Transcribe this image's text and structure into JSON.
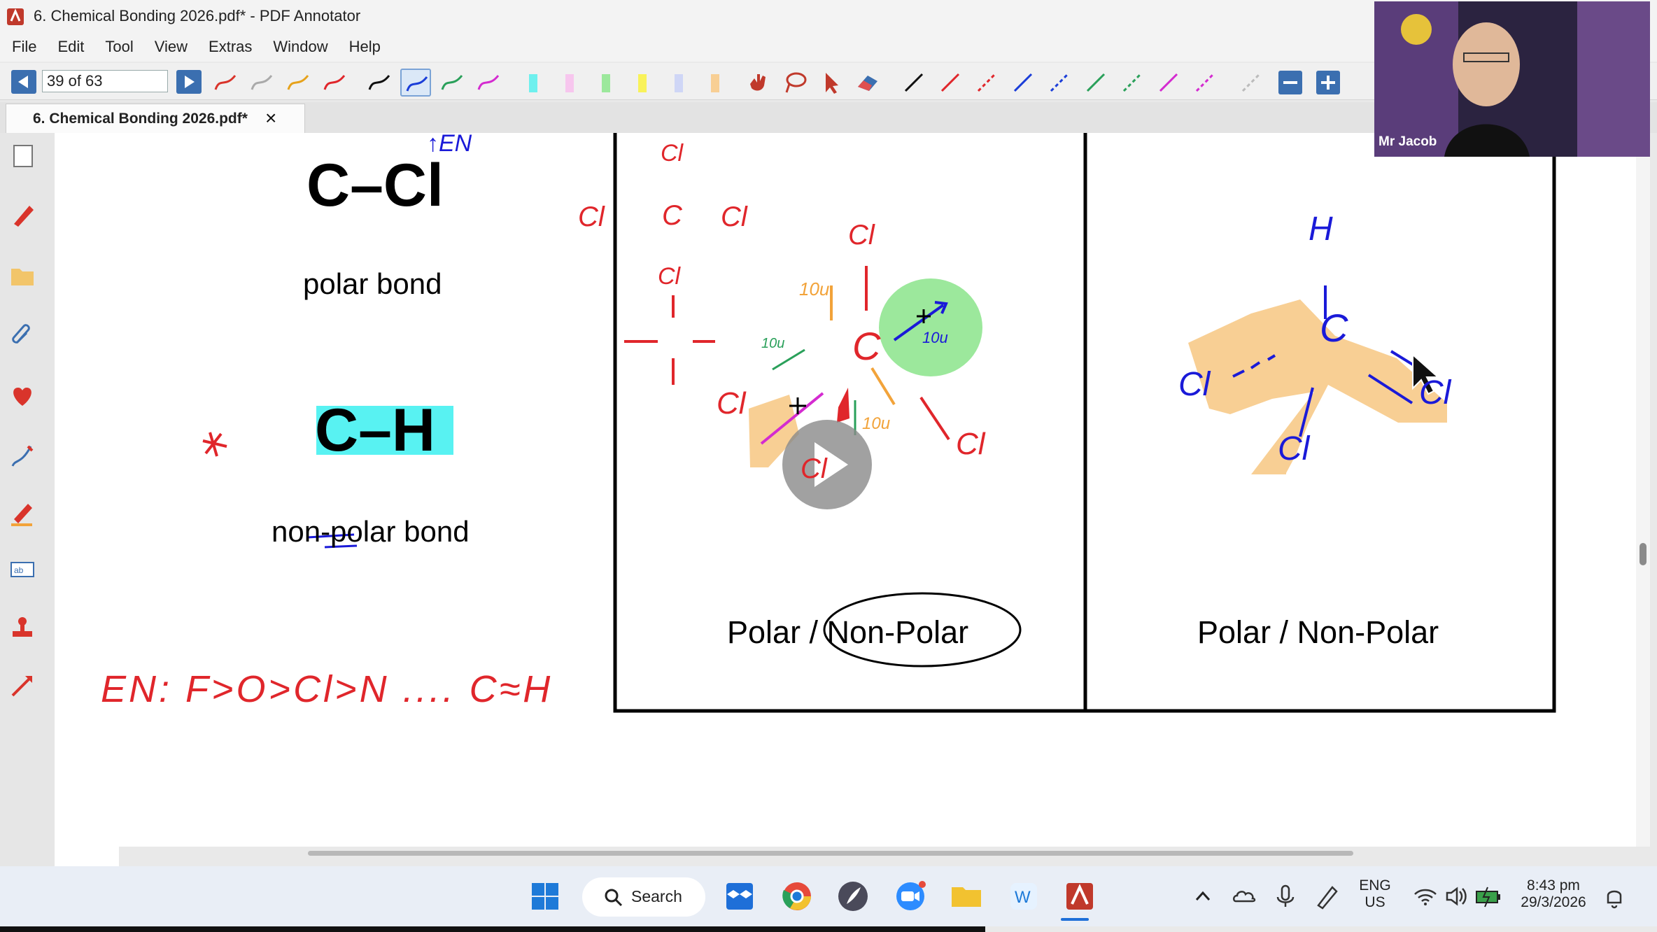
{
  "window": {
    "title": "6. Chemical Bonding 2026.pdf* - PDF Annotator"
  },
  "menu": [
    "File",
    "Edit",
    "Tool",
    "View",
    "Extras",
    "Window",
    "Help"
  ],
  "toolbar": {
    "page_indicator": "39 of 63"
  },
  "tab": {
    "label": "6. Chemical Bonding 2026.pdf*",
    "close": "×"
  },
  "slide": {
    "ccl_formula": "C–Cl",
    "polar_bond": "polar bond",
    "ch_formula": "C–H",
    "nonpolar_bond": "non-polar bond",
    "en_note": "EN: F>O>Cl>N .... C≈H",
    "panel1_question": "Polar / Non-Polar",
    "panel2_question": "Polar / Non-Polar"
  },
  "annotations": {
    "cl": "Cl",
    "c": "C",
    "h": "H",
    "ten": "↑EN",
    "dipole_10u": "10u"
  },
  "webcam": {
    "name": "Mr Jacob"
  },
  "taskbar": {
    "search_label": "Search",
    "language": "ENG",
    "region": "US",
    "time": "8:43 pm",
    "date": "29/3/2026"
  },
  "colors": {
    "accent": "#3b6fb0",
    "annotation_red": "#e0262b",
    "annotation_blue": "#1a1ad8",
    "highlight_cyan": "#58f2f2",
    "highlight_orange": "#f8cf94",
    "highlight_green": "#9ce89c"
  }
}
